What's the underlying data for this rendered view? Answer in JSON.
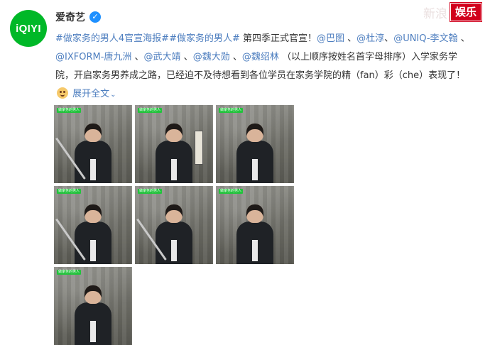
{
  "header": {
    "author_name": "爱奇艺",
    "avatar_logo": "iQIYI",
    "verified_mark": "✓",
    "corner_brand": "新浪",
    "corner_badge": "娱乐"
  },
  "post": {
    "hashtag1": "#做家务的男人4官宣海报#",
    "hashtag2": "#做家务的男人#",
    "text1": " 第四季正式官宣！",
    "mention1": "@巴图",
    "sep1": " 、",
    "mention2": "@杜淳",
    "sep2": "、",
    "mention3": "@UNIQ-李文翰",
    "sep3": " 、",
    "mention4": "@IXFORM-唐九洲",
    "sep4": " 、",
    "mention5": "@武大靖",
    "sep5": " 、",
    "mention6": "@魏大勋",
    "sep6": " 、",
    "mention7": "@魏绍林",
    "text2": " （以上顺序按姓名首字母排序）入学家务学院，开启家务男养成之路，已经迫不及待想看到各位学员在家务学院的精（fan）彩（che）表现了！",
    "expand_label": "展开全文",
    "expand_icon": "chevron-down-icon"
  },
  "images": [
    {
      "tag": "做家务的男人"
    },
    {
      "tag": "做家务的男人"
    },
    {
      "tag": "做家务的男人"
    },
    {
      "tag": "做家务的男人"
    },
    {
      "tag": "做家务的男人"
    },
    {
      "tag": "做家务的男人"
    },
    {
      "tag": "做家务的男人"
    }
  ],
  "colors": {
    "link": "#4d7ebf",
    "avatar_green": "#00b828",
    "badge_red": "#d1001c",
    "verified_blue": "#1e90ff"
  }
}
